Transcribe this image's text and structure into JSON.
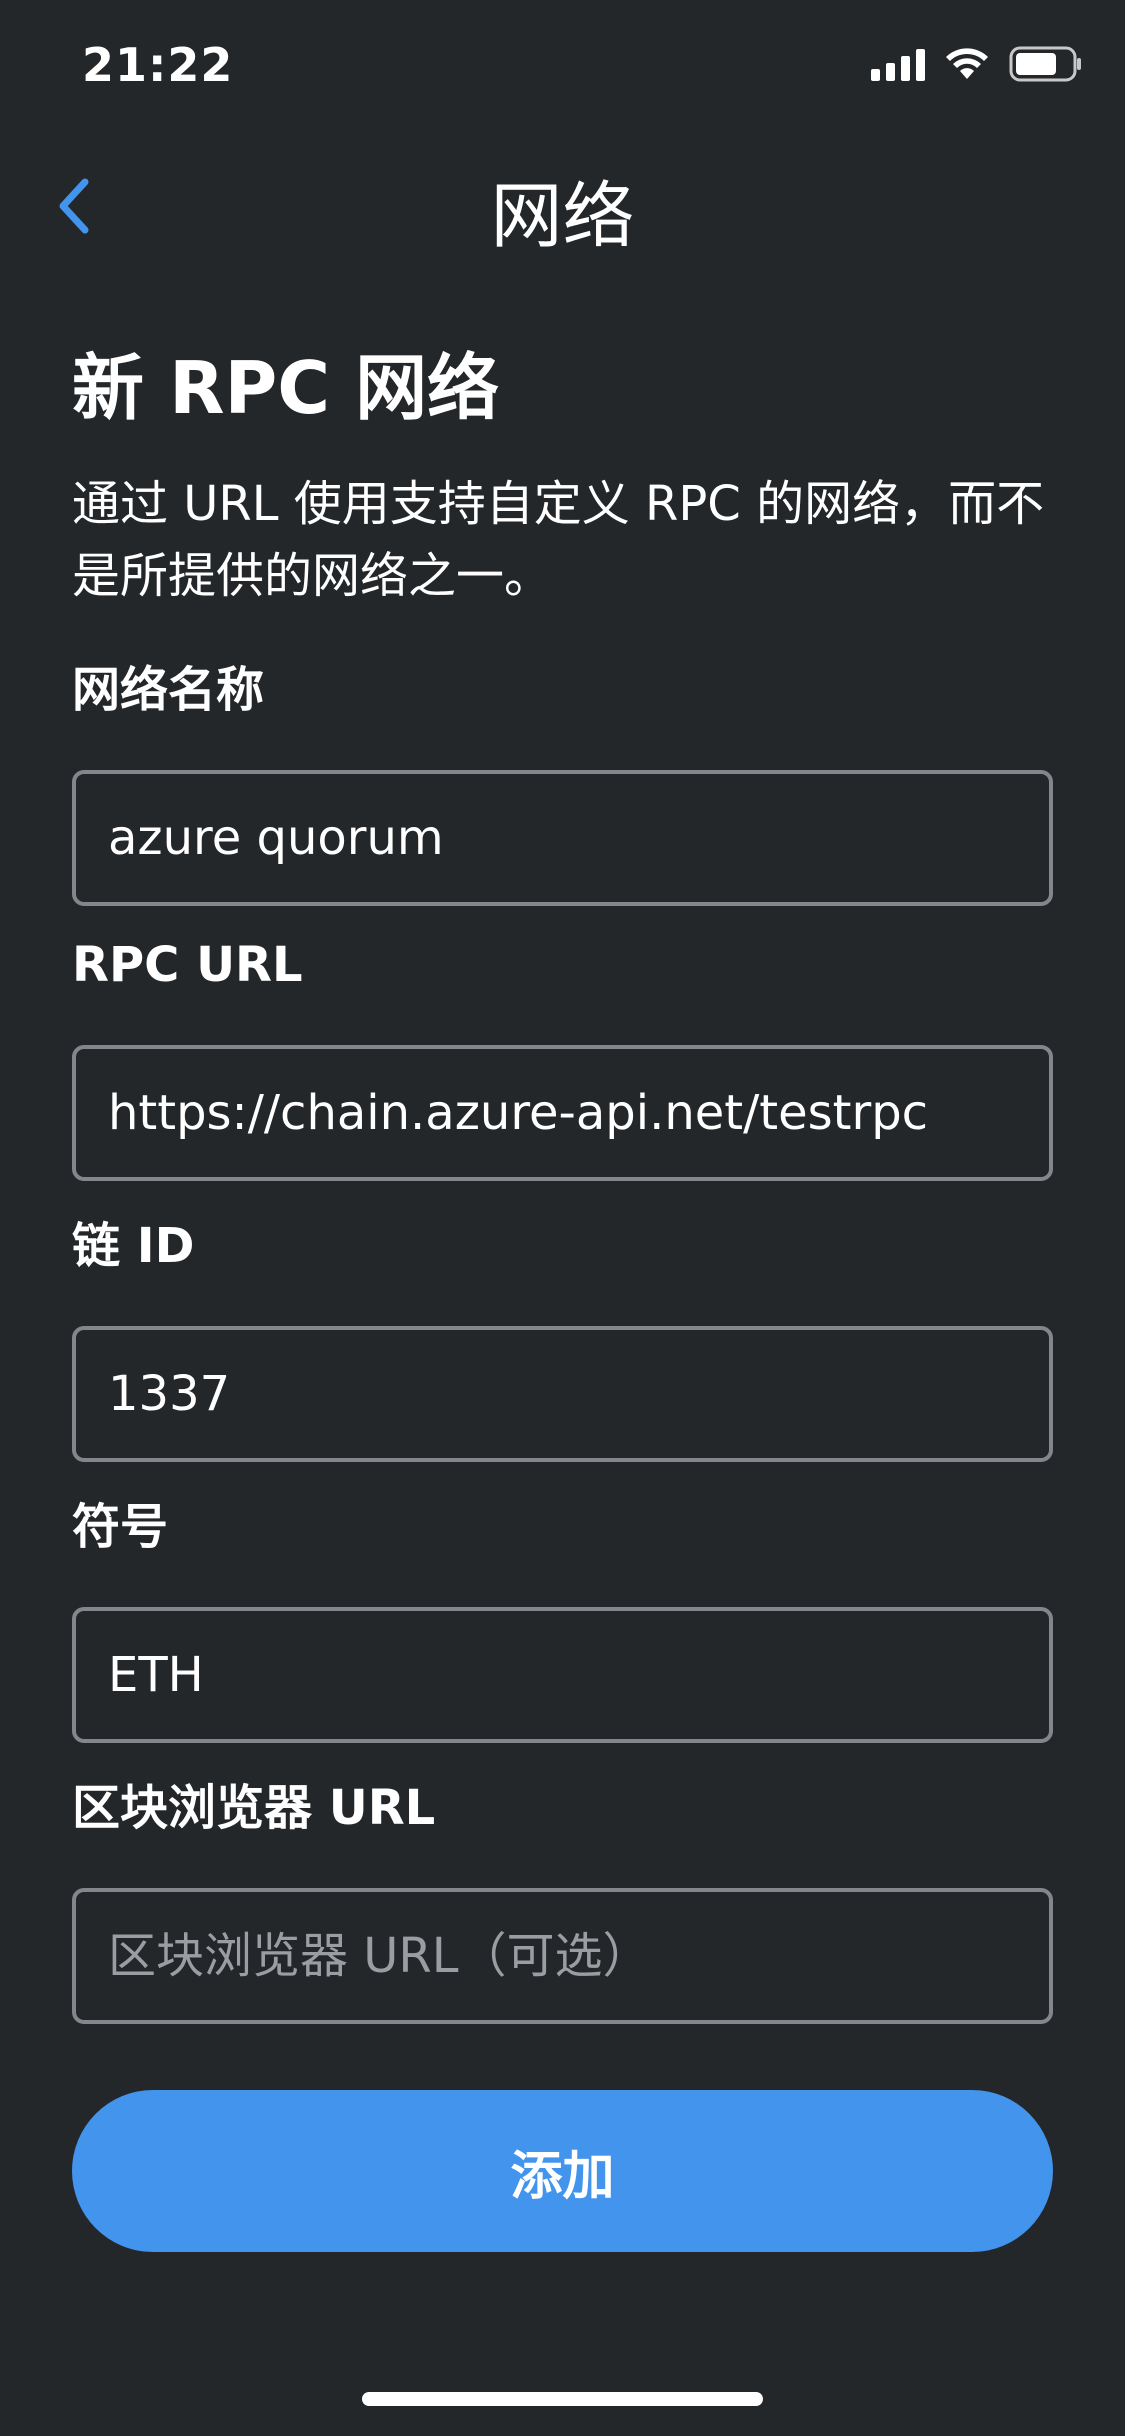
{
  "status_bar": {
    "time": "21:22"
  },
  "nav": {
    "title": "网络"
  },
  "heading": "新 RPC 网络",
  "description": "通过 URL 使用支持自定义 RPC 的网络，而不是所提供的网络之一。",
  "fields": [
    {
      "label": "网络名称",
      "value": "azure quorum",
      "placeholder": ""
    },
    {
      "label": "RPC URL",
      "value": "https://chain.azure-api.net/testrpc",
      "placeholder": ""
    },
    {
      "label": "链 ID",
      "value": "1337",
      "placeholder": ""
    },
    {
      "label": "符号",
      "value": "ETH",
      "placeholder": ""
    },
    {
      "label": "区块浏览器 URL",
      "value": "",
      "placeholder": "区块浏览器 URL（可选）"
    }
  ],
  "add_button": {
    "label": "添加"
  },
  "colors": {
    "background": "#24272a",
    "accent": "#4394ed",
    "input_border": "#83878b",
    "placeholder": "#9a9ea3"
  },
  "icons": {
    "back": "chevron-left-icon",
    "signal": "cellular-signal-icon",
    "wifi": "wifi-icon",
    "battery": "battery-icon"
  }
}
